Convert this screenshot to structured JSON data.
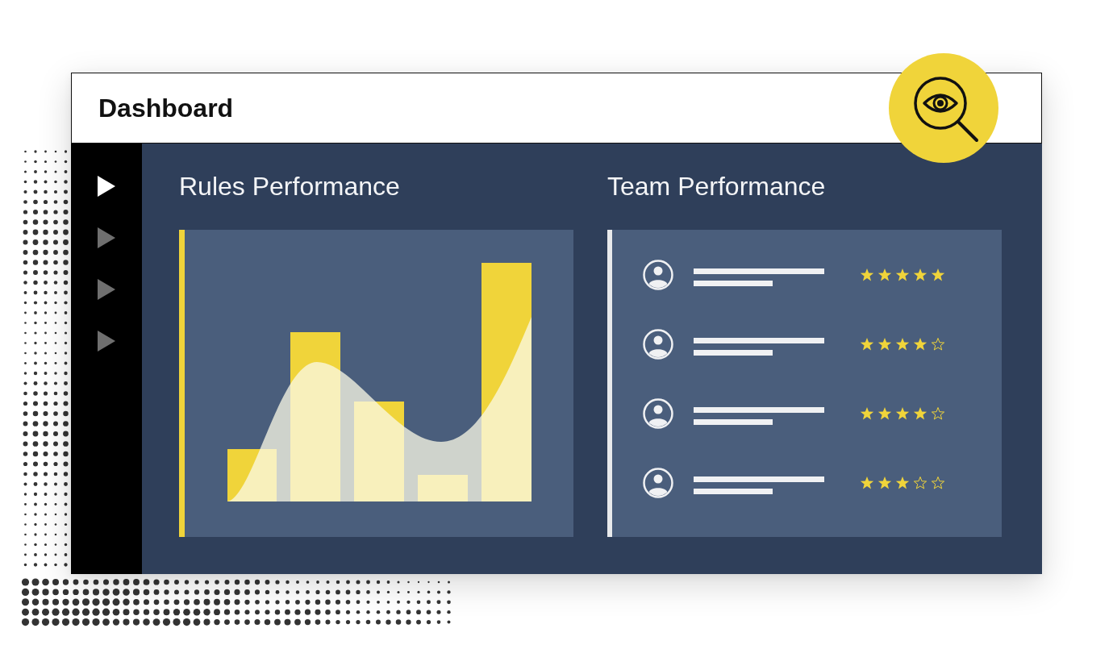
{
  "window": {
    "title": "Dashboard"
  },
  "sidebar": {
    "items": [
      {
        "selected": true
      },
      {
        "selected": false
      },
      {
        "selected": false
      },
      {
        "selected": false
      }
    ]
  },
  "panels": [
    {
      "kind": "chart",
      "title": "Rules Performance"
    },
    {
      "kind": "ratings",
      "title": "Team Performance",
      "members": [
        {
          "stars": 5
        },
        {
          "stars": 4
        },
        {
          "stars": 4
        },
        {
          "stars": 3
        }
      ]
    }
  ]
}
